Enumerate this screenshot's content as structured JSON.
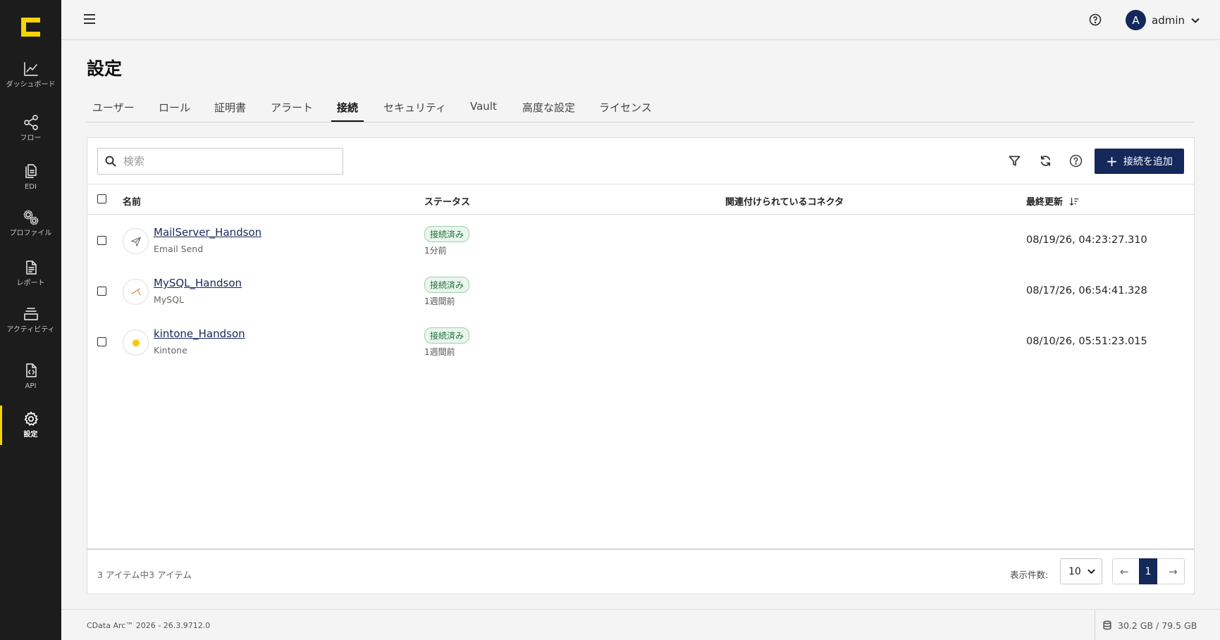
{
  "sidebar": {
    "items": [
      {
        "label": "ダッシュボード",
        "icon": "chart-line-icon"
      },
      {
        "label": "フロー",
        "icon": "share-nodes-icon"
      },
      {
        "label": "EDI",
        "icon": "documents-icon"
      },
      {
        "label": "プロファイル",
        "icon": "gears-icon"
      },
      {
        "label": "レポート",
        "icon": "report-file-icon"
      },
      {
        "label": "アクティビティ",
        "icon": "activity-stack-icon"
      },
      {
        "label": "API",
        "icon": "api-file-icon"
      },
      {
        "label": "設定",
        "icon": "gear-icon"
      }
    ],
    "active_index": 7,
    "accent_color": "#f5d400"
  },
  "topbar": {
    "user_initial": "A",
    "username": "admin"
  },
  "page": {
    "title": "設定"
  },
  "tabs": [
    {
      "label": "ユーザー"
    },
    {
      "label": "ロール"
    },
    {
      "label": "証明書"
    },
    {
      "label": "アラート"
    },
    {
      "label": "接続"
    },
    {
      "label": "セキュリティ"
    },
    {
      "label": "Vault"
    },
    {
      "label": "高度な設定"
    },
    {
      "label": "ライセンス"
    }
  ],
  "active_tab": "接続",
  "toolbar": {
    "search_placeholder": "検索",
    "add_button_label": "接続を追加",
    "add_button_color": "#14285a"
  },
  "table": {
    "columns": {
      "name": "名前",
      "status": "ステータス",
      "connectors": "関連付けられているコネクタ",
      "last_updated": "最終更新"
    },
    "rows": [
      {
        "name": "MailServer_Handson",
        "type": "Email Send",
        "status": "接続済み",
        "relative": "1分前",
        "last_updated": "08/19/26, 04:23:27.310",
        "icon": "paper-plane-icon"
      },
      {
        "name": "MySQL_Handson",
        "type": "MySQL",
        "status": "接続済み",
        "relative": "1週間前",
        "last_updated": "08/17/26, 06:54:41.328",
        "icon": "mysql-logo-icon"
      },
      {
        "name": "kintone_Handson",
        "type": "Kintone",
        "status": "接続済み",
        "relative": "1週間前",
        "last_updated": "08/10/26, 05:51:23.015",
        "icon": "kintone-logo-icon"
      }
    ]
  },
  "pagination": {
    "summary": "3 アイテム中3 アイテム",
    "per_page_label": "表示件数:",
    "per_page_value": "10",
    "current_page": "1"
  },
  "footer": {
    "version": "CData Arc™ 2026 - 26.3.9712.0",
    "storage": "30.2 GB / 79.5 GB"
  }
}
